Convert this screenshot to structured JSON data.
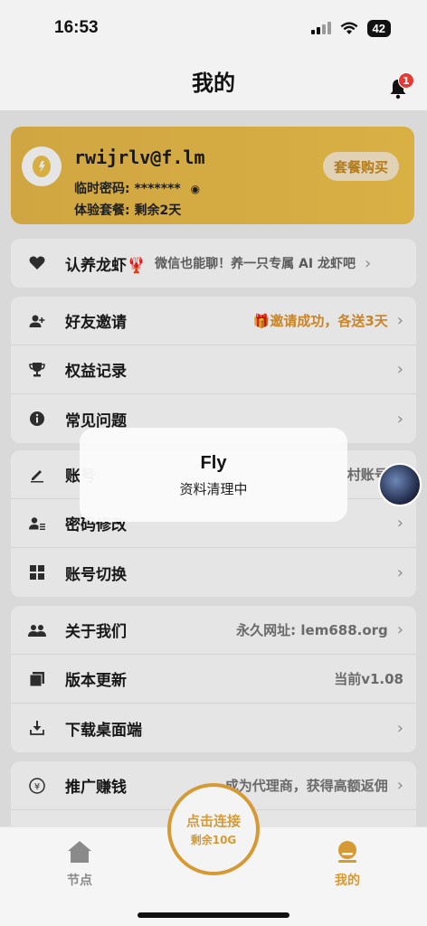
{
  "status_bar": {
    "time": "16:53",
    "battery": "42"
  },
  "header": {
    "title": "我的",
    "notification_count": "1"
  },
  "profile": {
    "email": "rwijrlv@f.lm",
    "password_label": "临时密码: *******",
    "plan_label": "体验套餐: 剩余2天",
    "buy_button": "套餐购买"
  },
  "adopt": {
    "label": "认养龙虾🦞",
    "description": "微信也能聊！养一只专属 AI 龙虾吧"
  },
  "group2": [
    {
      "label": "好友邀请",
      "value": "🎁邀请成功，各送3天"
    },
    {
      "label": "权益记录",
      "value": ""
    },
    {
      "label": "常见问题",
      "value": ""
    }
  ],
  "group3": [
    {
      "label": "账号",
      "value": "村账号"
    },
    {
      "label": "密码修改",
      "value": ""
    },
    {
      "label": "账号切换",
      "value": ""
    }
  ],
  "group4": [
    {
      "label": "关于我们",
      "value": "永久网址: lem688.org"
    },
    {
      "label": "版本更新",
      "value": "当前v1.08"
    },
    {
      "label": "下载桌面端",
      "value": ""
    }
  ],
  "group5": [
    {
      "label": "推广赚钱",
      "value": "成为代理商，获得高额返佣"
    },
    {
      "label": "",
      "value": ""
    }
  ],
  "toast": {
    "title": "Fly",
    "message": "资料清理中"
  },
  "connect": {
    "main": "点击连接",
    "sub": "剩余10G"
  },
  "tabs": {
    "nodes": "节点",
    "mine": "我的"
  },
  "colors": {
    "accent": "#d59a34",
    "card": "#f1c44c"
  }
}
